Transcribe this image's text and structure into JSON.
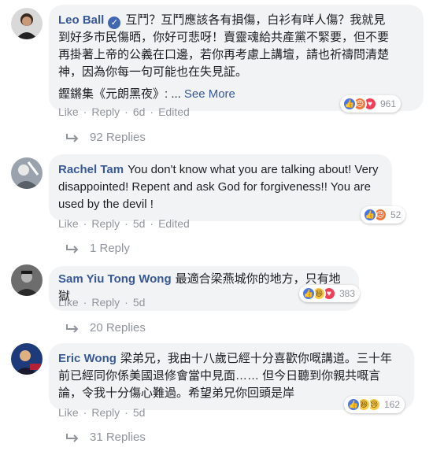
{
  "comments": [
    {
      "author": "Leo Ball",
      "verified_mark": "✓",
      "text_lines": [
        "互鬥？互鬥應該各有損傷，白衫有咩人傷？我就見",
        "到好多市民傷晒，你好可悲呀！賣靈魂給共產黨不緊要，但不要",
        "再掛著上帝的公義在口邊，若你再考慮上講壇，請也祈禱問清楚",
        "神，因為你每一句可能也在失見証。"
      ],
      "tail_text": "鏗鏘集《元朗黑夜》: ...",
      "see_more": "See More",
      "reaction_icons": [
        "like",
        "angry",
        "love"
      ],
      "reaction_count": "961",
      "actions": {
        "like": "Like",
        "reply": "Reply",
        "time": "6d",
        "edited": "Edited"
      },
      "replies": "92 Replies"
    },
    {
      "author": "Rachel Tam",
      "text_lines": [
        "You don't know what you are talking about! Very",
        "disappointed! Repent and ask God for forgiveness!! You are",
        "used by the devil !"
      ],
      "reaction_icons": [
        "like",
        "angry"
      ],
      "reaction_count": "52",
      "actions": {
        "like": "Like",
        "reply": "Reply",
        "time": "5d",
        "edited": "Edited"
      },
      "replies": "1 Reply"
    },
    {
      "author": "Sam Yiu Tong Wong",
      "text_lines": [
        "最適合梁燕城你的地方，只有地獄"
      ],
      "reaction_icons": [
        "like",
        "haha",
        "love"
      ],
      "reaction_count": "383",
      "actions": {
        "like": "Like",
        "reply": "Reply",
        "time": "5d"
      },
      "replies": "20 Replies"
    },
    {
      "author": "Eric Wong",
      "text_lines": [
        "梁弟兄，我由十八歲已經十分喜歡你嘅講道。三十年",
        "前已經同你係美國退修會當中見面…… 但今日聽到你親共嘅言",
        "論，令我十分傷心難過。希望弟兄你回頭是岸"
      ],
      "reaction_icons": [
        "like",
        "haha",
        "sad"
      ],
      "reaction_count": "162",
      "actions": {
        "like": "Like",
        "reply": "Reply",
        "time": "5d"
      },
      "replies": "31 Replies"
    }
  ],
  "reaction_glyphs": {
    "like": "👍",
    "angry": "😠",
    "love": "♥",
    "haha": "😆",
    "sad": "😢"
  },
  "colors": {
    "author": "#385898",
    "bubble": "#f2f3f5",
    "meta": "#90949c"
  }
}
